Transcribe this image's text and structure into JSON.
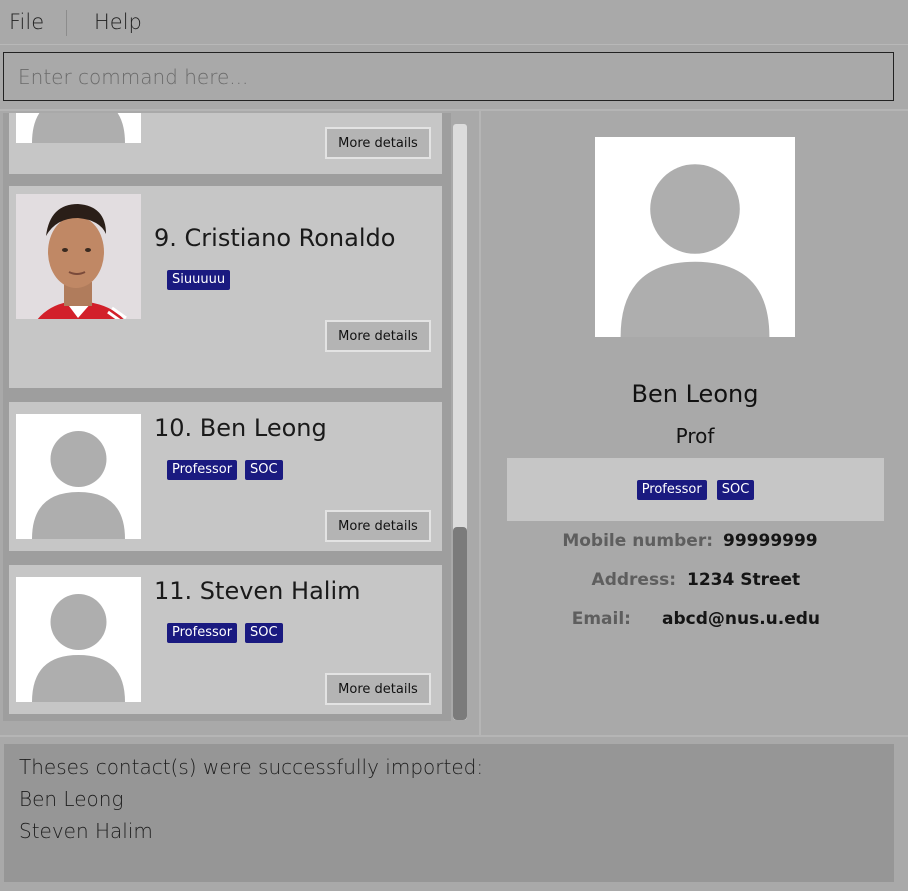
{
  "menu": {
    "file": "File",
    "help": "Help"
  },
  "command": {
    "placeholder": "Enter command here..."
  },
  "list": {
    "cards": [
      {
        "button": "More details"
      },
      {
        "index_name": "9. Cristiano Ronaldo",
        "tags": [
          "Siuuuuu"
        ],
        "button": "More details",
        "photo": "cristiano-ronaldo-photo"
      },
      {
        "index_name": "10. Ben Leong",
        "tags": [
          "Professor",
          "SOC"
        ],
        "button": "More details",
        "photo": "default-avatar"
      },
      {
        "index_name": "11. Steven Halim",
        "tags": [
          "Professor",
          "SOC"
        ],
        "button": "More details",
        "photo": "default-avatar"
      }
    ]
  },
  "detail": {
    "name": "Ben Leong",
    "role": "Prof",
    "tags": [
      "Professor",
      "SOC"
    ],
    "mobile_label": "Mobile number:",
    "mobile_value": "99999999",
    "address_label": "Address:",
    "address_value": "1234 Street",
    "email_label": "Email:",
    "email_value": "abcd@nus.u.edu"
  },
  "result": {
    "lines": [
      "Theses contact(s) were successfully imported:",
      "Ben Leong",
      "Steven Halim"
    ]
  },
  "colors": {
    "tag_bg": "#1a1a80",
    "card_bg": "#c6c6c6",
    "app_bg": "#a9a9a9"
  }
}
